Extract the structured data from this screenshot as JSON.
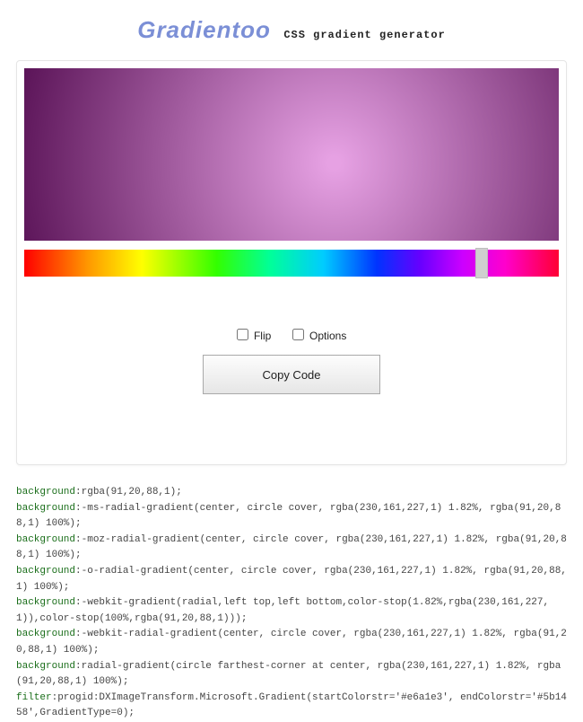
{
  "header": {
    "logo": "Gradientoo",
    "tagline": "CSS gradient generator"
  },
  "gradient": {
    "color_inner_rgba": "rgba(230,161,227,1)",
    "color_outer_rgba": "rgba(91,20,88,1)",
    "inner_stop_percent": 1.82,
    "outer_stop_percent": 100,
    "start_hex": "#e6a1e3",
    "end_hex": "#5b1458",
    "hue_slider_position_percent": 85.5
  },
  "controls": {
    "flip_label": "Flip",
    "flip_checked": false,
    "options_label": "Options",
    "options_checked": false,
    "copy_button_label": "Copy Code"
  },
  "code_lines": [
    {
      "prop": "background",
      "value": ":rgba(91,20,88,1);"
    },
    {
      "prop": "background",
      "value": ":-ms-radial-gradient(center, circle cover, rgba(230,161,227,1) 1.82%, rgba(91,20,88,1) 100%);"
    },
    {
      "prop": "background",
      "value": ":-moz-radial-gradient(center, circle cover, rgba(230,161,227,1) 1.82%, rgba(91,20,88,1) 100%);"
    },
    {
      "prop": "background",
      "value": ":-o-radial-gradient(center, circle cover, rgba(230,161,227,1) 1.82%, rgba(91,20,88,1) 100%);"
    },
    {
      "prop": "background",
      "value": ":-webkit-gradient(radial,left top,left bottom,color-stop(1.82%,rgba(230,161,227,1)),color-stop(100%,rgba(91,20,88,1)));"
    },
    {
      "prop": "background",
      "value": ":-webkit-radial-gradient(center, circle cover, rgba(230,161,227,1) 1.82%, rgba(91,20,88,1) 100%);"
    },
    {
      "prop": "background",
      "value": ":radial-gradient(circle farthest-corner at center, rgba(230,161,227,1) 1.82%, rgba(91,20,88,1) 100%);"
    },
    {
      "prop": "filter",
      "value": ":progid:DXImageTransform.Microsoft.Gradient(startColorstr='#e6a1e3', endColorstr='#5b1458',GradientType=0);"
    }
  ]
}
